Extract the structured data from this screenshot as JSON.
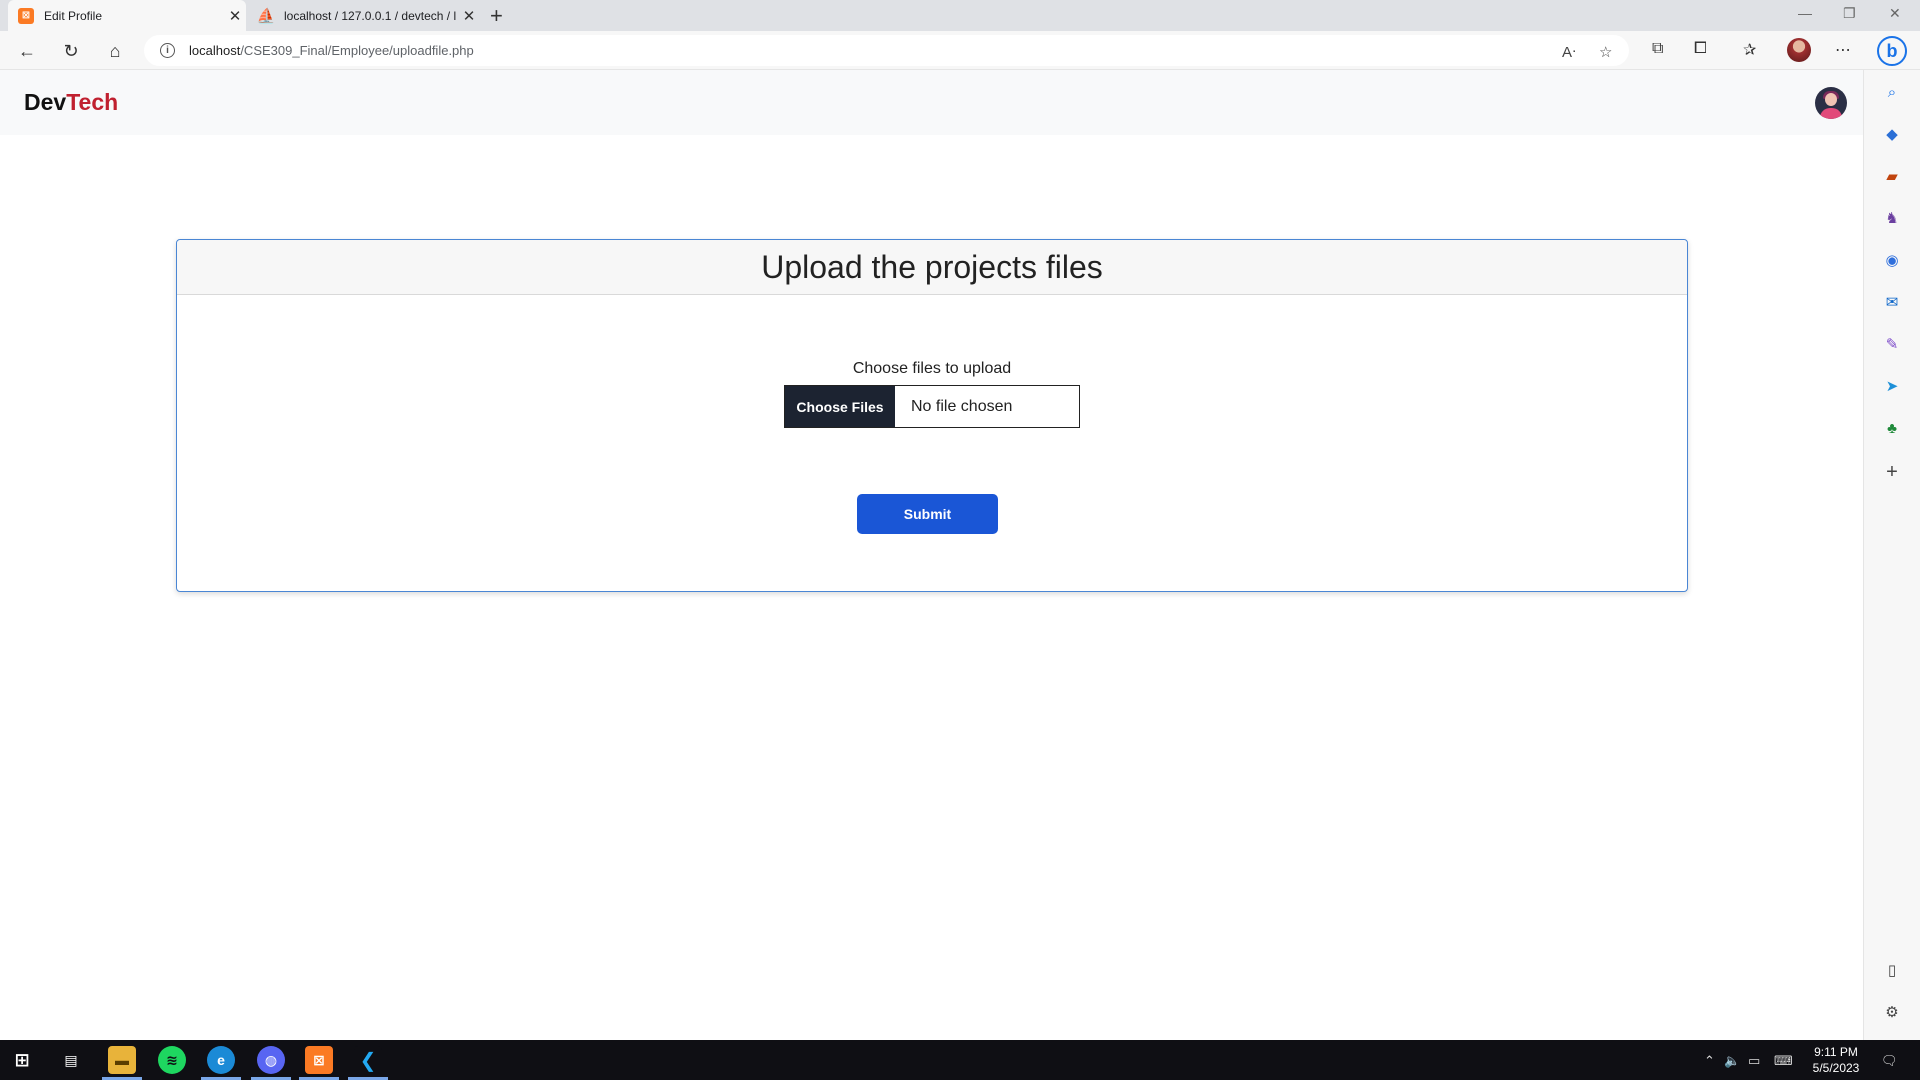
{
  "browser": {
    "tabs": [
      {
        "title": "Edit Profile",
        "active": true,
        "favicon": "xampp-icon"
      },
      {
        "title": "localhost / 127.0.0.1 / devtech / l",
        "active": false,
        "favicon": "phpmyadmin-icon"
      }
    ],
    "new_tab_glyph": "+",
    "url_host": "localhost",
    "url_path": "/CSE309_Final/Employee/uploadfile.php"
  },
  "site": {
    "brand_first": "Dev",
    "brand_second": "Tech"
  },
  "card": {
    "title": "Upload the projects files",
    "upload_label": "Choose files to upload",
    "file_button": "Choose Files",
    "file_status": "No file chosen",
    "submit": "Submit"
  },
  "taskbar": {
    "time": "9:11 PM",
    "date": "5/5/2023"
  },
  "colors": {
    "brand_accent": "#c0202f",
    "card_border": "#4a86d4",
    "submit_bg": "#1a56d6",
    "file_button_bg": "#1c2331"
  }
}
